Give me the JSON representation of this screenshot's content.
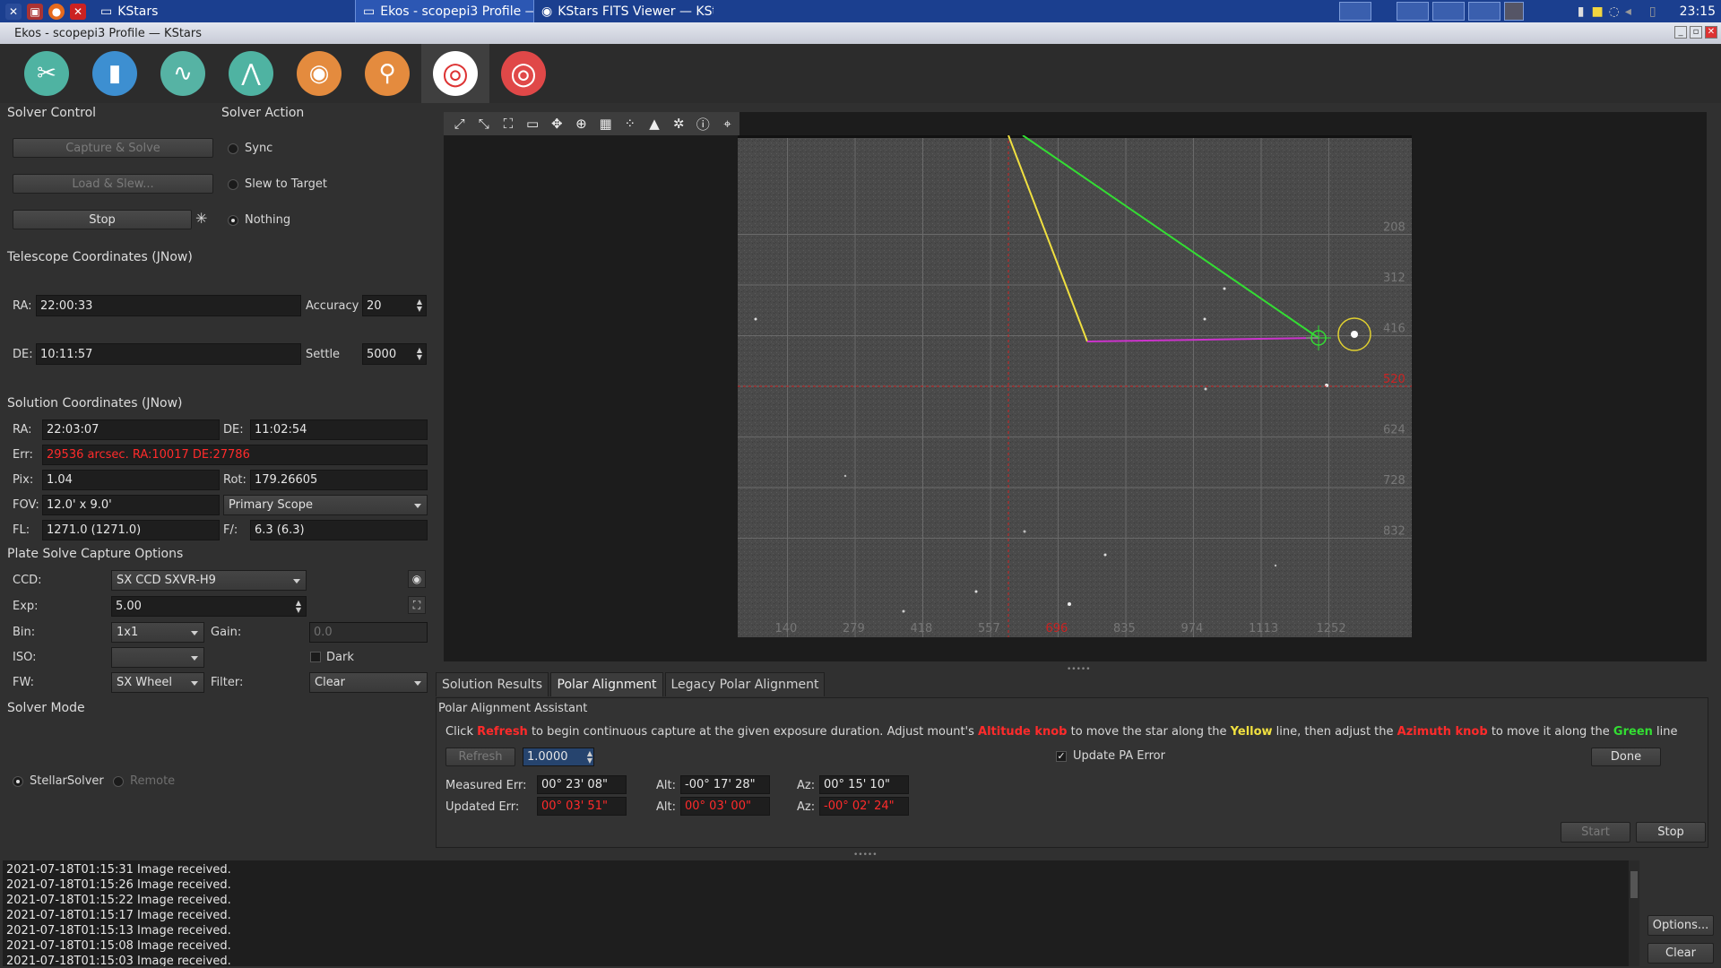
{
  "taskbar": {
    "tasks": [
      {
        "label": "KStars",
        "active": false
      },
      {
        "label": "Ekos - scopepi3 Profile — ...",
        "active": true
      },
      {
        "label": "KStars FITS Viewer — KSt...",
        "active": false
      }
    ],
    "clock": "23:15"
  },
  "window": {
    "title": "Ekos - scopepi3 Profile — KStars"
  },
  "modules": [
    "setup-icon",
    "scheduler-icon",
    "analyze-icon",
    "mount-icon",
    "capture-icon",
    "focus-icon",
    "align-icon",
    "guide-icon"
  ],
  "solver_control": {
    "title": "Solver Control",
    "capture_solve": "Capture & Solve",
    "load_slew": "Load & Slew...",
    "stop": "Stop"
  },
  "solver_action": {
    "title": "Solver Action",
    "options": [
      "Sync",
      "Slew to Target",
      "Nothing"
    ],
    "selected": "Nothing"
  },
  "telescope": {
    "title": "Telescope Coordinates (JNow)",
    "ra_label": "RA:",
    "ra": "22:00:33",
    "de_label": "DE:",
    "de": "10:11:57",
    "accuracy_label": "Accuracy",
    "accuracy": "20",
    "settle_label": "Settle",
    "settle": "5000"
  },
  "solution": {
    "title": "Solution Coordinates (JNow)",
    "ra_label": "RA:",
    "ra": "22:03:07",
    "de_label": "DE:",
    "de": "11:02:54",
    "err_label": "Err:",
    "err": "29536 arcsec. RA:10017 DE:27786",
    "pix_label": "Pix:",
    "pix": "1.04",
    "rot_label": "Rot:",
    "rot": "179.26605",
    "fov_label": "FOV:",
    "fov": "12.0' x 9.0'",
    "scope": "Primary Scope",
    "fl_label": "FL:",
    "fl": "1271.0 (1271.0)",
    "f_label": "F/:",
    "f": "6.3 (6.3)"
  },
  "capture_options": {
    "title": "Plate Solve Capture Options",
    "ccd_label": "CCD:",
    "ccd": "SX CCD SXVR-H9",
    "exp_label": "Exp:",
    "exp": "5.00",
    "bin_label": "Bin:",
    "bin": "1x1",
    "gain_label": "Gain:",
    "gain": "0.0",
    "iso_label": "ISO:",
    "iso": "",
    "dark_label": "Dark",
    "fw_label": "FW:",
    "fw": "SX Wheel",
    "filter_label": "Filter:",
    "filter": "Clear"
  },
  "solver_mode": {
    "title": "Solver Mode",
    "options": [
      "StellarSolver",
      "Remote"
    ],
    "selected": "StellarSolver"
  },
  "viewer": {
    "toolbar_icons": [
      "zoom-in-icon",
      "zoom-out-icon",
      "zoom-default-icon",
      "zoom-fit-icon",
      "pan-icon",
      "crosshair-icon",
      "grid-icon",
      "stars-icon",
      "histogram-icon",
      "target-icon",
      "info-icon",
      "center-target-icon"
    ],
    "x_ticks": [
      "140",
      "279",
      "418",
      "557",
      "696",
      "835",
      "974",
      "1113",
      "1252"
    ],
    "y_ticks": [
      "208",
      "312",
      "416",
      "520",
      "624",
      "728",
      "832"
    ]
  },
  "tabs": [
    "Solution Results",
    "Polar Alignment",
    "Legacy Polar Alignment"
  ],
  "selected_tab": "Polar Alignment",
  "pa": {
    "title": "Polar Alignment Assistant",
    "instr_1": "Click ",
    "instr_refresh": "Refresh",
    "instr_2": " to begin continuous capture at the given exposure duration. Adjust mount's ",
    "instr_alt": "Altitude knob",
    "instr_3": " to move the star along the ",
    "instr_yellow": "Yellow",
    "instr_4": " line, then adjust the ",
    "instr_az": "Azimuth knob",
    "instr_5": " to move it along the ",
    "instr_green": "Green",
    "instr_6": " line",
    "refresh": "Refresh",
    "exposure": "1.0000",
    "update_error": "Update PA Error",
    "done": "Done",
    "measured_label": "Measured Err:",
    "measured": "00° 23' 08\"",
    "updated_label": "Updated Err:",
    "updated": "00° 03' 51\"",
    "alt_label": "Alt:",
    "alt_measured": "-00° 17' 28\"",
    "alt_updated": "00° 03' 00\"",
    "az_label": "Az:",
    "az_measured": "00° 15' 10\"",
    "az_updated": "-00° 02' 24\"",
    "start": "Start",
    "stop": "Stop"
  },
  "log": [
    "2021-07-18T01:15:31 Image received.",
    "2021-07-18T01:15:26 Image received.",
    "2021-07-18T01:15:22 Image received.",
    "2021-07-18T01:15:17 Image received.",
    "2021-07-18T01:15:13 Image received.",
    "2021-07-18T01:15:08 Image received.",
    "2021-07-18T01:15:03 Image received."
  ],
  "log_buttons": {
    "options": "Options...",
    "clear": "Clear"
  },
  "colors": {
    "red": "#ff2b2b",
    "yellow": "#f0e040",
    "green": "#33dd33",
    "magenta": "#cc33cc"
  }
}
